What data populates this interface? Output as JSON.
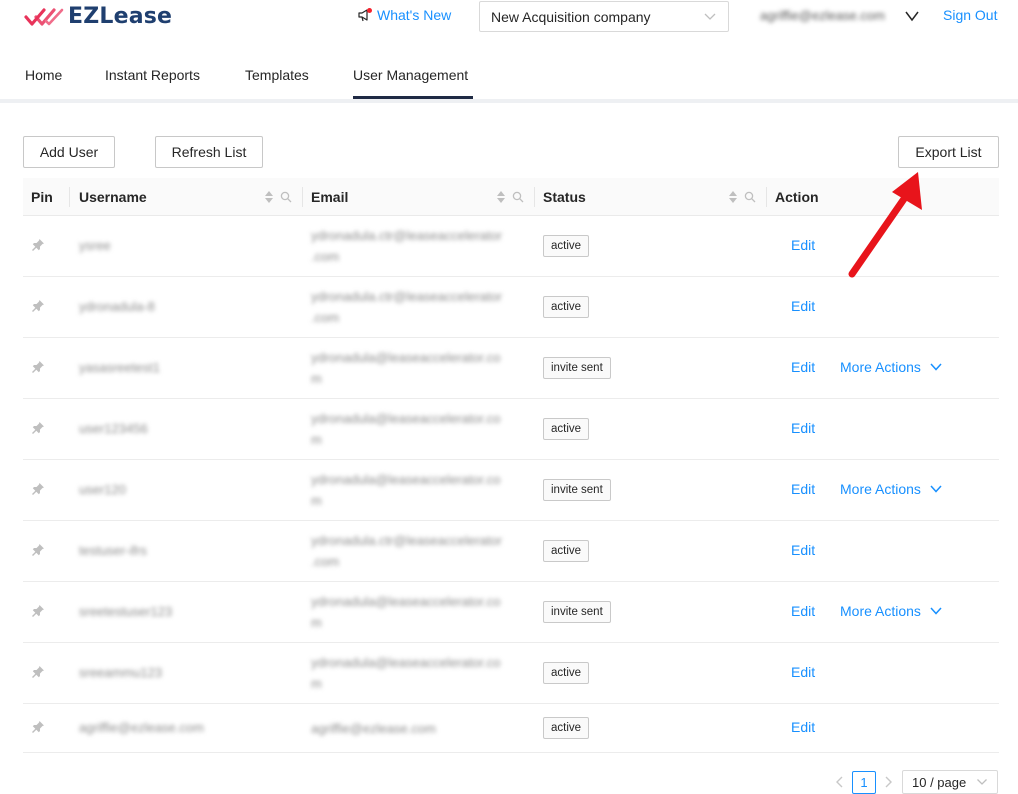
{
  "header": {
    "logo_text": "EZLease",
    "whats_new": "What's New",
    "company": "New Acquisition company",
    "user_email": "agriffie@ezlease.com",
    "sign_out": "Sign Out"
  },
  "nav": {
    "items": [
      {
        "label": "Home"
      },
      {
        "label": "Instant Reports"
      },
      {
        "label": "Templates"
      },
      {
        "label": "User Management"
      }
    ],
    "active": "User Management"
  },
  "toolbar": {
    "add_user": "Add User",
    "refresh_list": "Refresh List",
    "export_list": "Export List"
  },
  "table": {
    "columns": [
      "Pin",
      "Username",
      "Email",
      "Status",
      "Action"
    ],
    "rows": [
      {
        "username": "ysree",
        "email": "ydronadula.ctr@leaseaccelerator.com",
        "email_lines": [
          "ydronadula.ctr@leaseaccelerator",
          ".com"
        ],
        "status": "active",
        "edit": "Edit",
        "more": ""
      },
      {
        "username": "ydronadula-8",
        "email": "ydronadula.ctr@leaseaccelerator.com",
        "email_lines": [
          "ydronadula.ctr@leaseaccelerator",
          ".com"
        ],
        "status": "active",
        "edit": "Edit",
        "more": ""
      },
      {
        "username": "yasasreetest1",
        "email": "ydronadula@leaseaccelerator.com",
        "email_lines": [
          "ydronadula@leaseaccelerator.co",
          "m"
        ],
        "status": "invite sent",
        "edit": "Edit",
        "more": "More Actions"
      },
      {
        "username": "user123456",
        "email": "ydronadula@leaseaccelerator.com",
        "email_lines": [
          "ydronadula@leaseaccelerator.co",
          "m"
        ],
        "status": "active",
        "edit": "Edit",
        "more": ""
      },
      {
        "username": "user120",
        "email": "ydronadula@leaseaccelerator.com",
        "email_lines": [
          "ydronadula@leaseaccelerator.co",
          "m"
        ],
        "status": "invite sent",
        "edit": "Edit",
        "more": "More Actions"
      },
      {
        "username": "testuser-ifrs",
        "email": "ydronadula.ctr@leaseaccelerator.com",
        "email_lines": [
          "ydronadula.ctr@leaseaccelerator",
          ".com"
        ],
        "status": "active",
        "edit": "Edit",
        "more": ""
      },
      {
        "username": "sreetestuser123",
        "email": "ydronadula@leaseaccelerator.com",
        "email_lines": [
          "ydronadula@leaseaccelerator.co",
          "m"
        ],
        "status": "invite sent",
        "edit": "Edit",
        "more": "More Actions"
      },
      {
        "username": "sreeammu123",
        "email": "ydronadula@leaseaccelerator.com",
        "email_lines": [
          "ydronadula@leaseaccelerator.co",
          "m"
        ],
        "status": "active",
        "edit": "Edit",
        "more": ""
      },
      {
        "username": "agriffie@ezlease.com",
        "email": "agriffie@ezlease.com",
        "email_lines": [
          "agriffie@ezlease.com"
        ],
        "status": "active",
        "edit": "Edit",
        "more": ""
      }
    ]
  },
  "pagination": {
    "current_page": "1",
    "page_size": "10 / page"
  },
  "icons": {
    "pin": "pin-icon",
    "sort": "sort-icon",
    "search": "search-icon",
    "chevron": "chevron-down-icon",
    "megaphone": "megaphone-icon"
  },
  "colors": {
    "link": "#1890ff",
    "logo": "#1f3f6f",
    "logo_check": "#e8335a",
    "arrow": "#e8141b",
    "nav_active": "#1f2a44"
  }
}
